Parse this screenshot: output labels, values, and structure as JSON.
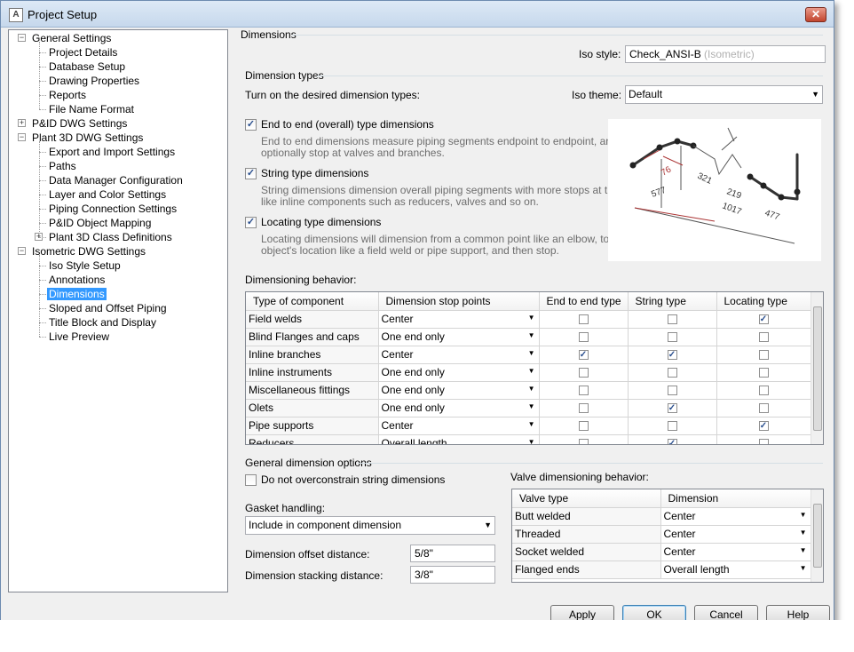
{
  "window": {
    "title": "Project Setup",
    "close_label": "✕"
  },
  "tree": [
    {
      "label": "General Settings",
      "level": 0,
      "expander": "−"
    },
    {
      "label": "Project Details",
      "level": 1
    },
    {
      "label": "Database Setup",
      "level": 1
    },
    {
      "label": "Drawing Properties",
      "level": 1
    },
    {
      "label": "Reports",
      "level": 1
    },
    {
      "label": "File Name Format",
      "level": 1
    },
    {
      "label": "P&ID DWG Settings",
      "level": 0,
      "expander": "+"
    },
    {
      "label": "Plant 3D DWG Settings",
      "level": 0,
      "expander": "−"
    },
    {
      "label": "Export and Import Settings",
      "level": 1
    },
    {
      "label": "Paths",
      "level": 1
    },
    {
      "label": "Data Manager Configuration",
      "level": 1
    },
    {
      "label": "Layer and Color Settings",
      "level": 1
    },
    {
      "label": "Piping Connection Settings",
      "level": 1
    },
    {
      "label": "P&ID Object Mapping",
      "level": 1
    },
    {
      "label": "Plant 3D Class Definitions",
      "level": 1,
      "expander": "+"
    },
    {
      "label": "Isometric DWG Settings",
      "level": 0,
      "expander": "−"
    },
    {
      "label": "Iso Style Setup",
      "level": 1
    },
    {
      "label": "Annotations",
      "level": 1
    },
    {
      "label": "Dimensions",
      "level": 1,
      "selected": true
    },
    {
      "label": "Sloped and Offset Piping",
      "level": 1
    },
    {
      "label": "Title Block and Display",
      "level": 1
    },
    {
      "label": "Live Preview",
      "level": 1
    }
  ],
  "panel": {
    "heading": "Dimensions",
    "iso_style_label": "Iso style:",
    "iso_style_value": "Check_ANSI-B",
    "iso_style_suffix": "(Isometric)",
    "dimension_types_label": "Dimension types",
    "turn_on_label": "Turn on the desired dimension types:",
    "iso_theme_label": "Iso theme:",
    "iso_theme_value": "Default",
    "types": [
      {
        "label": "End to end (overall) type dimensions",
        "checked": true,
        "desc1": "End to end dimensions measure piping segments endpoint to endpoint, and can",
        "desc2": "optionally stop at valves and branches."
      },
      {
        "label": "String type dimensions",
        "checked": true,
        "desc1": "String dimensions dimension overall piping segments with more stops at things",
        "desc2": "like inline components such as reducers, valves and so on."
      },
      {
        "label": "Locating type dimensions",
        "checked": true,
        "desc1": "Locating dimensions will dimension from a common point like an elbow, to an",
        "desc2": "object's location like a field weld or pipe support, and then stop."
      }
    ],
    "illustration": {
      "dims": [
        "76",
        "321",
        "577",
        "219",
        "1017",
        "477"
      ]
    },
    "behavior_label": "Dimensioning behavior:",
    "behavior_columns": [
      "Type of component",
      "Dimension stop points",
      "End to end type",
      "String type",
      "Locating type"
    ],
    "behavior_rows": [
      {
        "type": "Field welds",
        "stop": "Center",
        "end": false,
        "string": false,
        "locating": true
      },
      {
        "type": "Blind Flanges and caps",
        "stop": "One end only",
        "end": false,
        "string": false,
        "locating": false
      },
      {
        "type": "Inline branches",
        "stop": "Center",
        "end": true,
        "string": true,
        "locating": false
      },
      {
        "type": "Inline instruments",
        "stop": "One end only",
        "end": false,
        "string": false,
        "locating": false
      },
      {
        "type": "Miscellaneous fittings",
        "stop": "One end only",
        "end": false,
        "string": false,
        "locating": false
      },
      {
        "type": "Olets",
        "stop": "One end only",
        "end": false,
        "string": true,
        "locating": false
      },
      {
        "type": "Pipe supports",
        "stop": "Center",
        "end": false,
        "string": false,
        "locating": true
      },
      {
        "type": "Reducers",
        "stop": "Overall length",
        "end": false,
        "string": true,
        "locating": false
      }
    ],
    "general_label": "General dimension options",
    "no_overconstrain_label": "Do not overconstrain string dimensions",
    "gasket_label": "Gasket handling:",
    "gasket_value": "Include in component dimension",
    "offset_label": "Dimension offset distance:",
    "offset_value": "5/8\"",
    "stacking_label": "Dimension stacking distance:",
    "stacking_value": "3/8\"",
    "valve_label": "Valve dimensioning behavior:",
    "valve_columns": [
      "Valve type",
      "Dimension"
    ],
    "valve_rows": [
      {
        "type": "Butt welded",
        "dimension": "Center"
      },
      {
        "type": "Threaded",
        "dimension": "Center"
      },
      {
        "type": "Socket welded",
        "dimension": "Center"
      },
      {
        "type": "Flanged ends",
        "dimension": "Overall length"
      }
    ]
  },
  "buttons": {
    "apply": "Apply",
    "ok": "OK",
    "cancel": "Cancel",
    "help": "Help"
  },
  "check_mark": "✓",
  "dropdown_arrow": "▼"
}
